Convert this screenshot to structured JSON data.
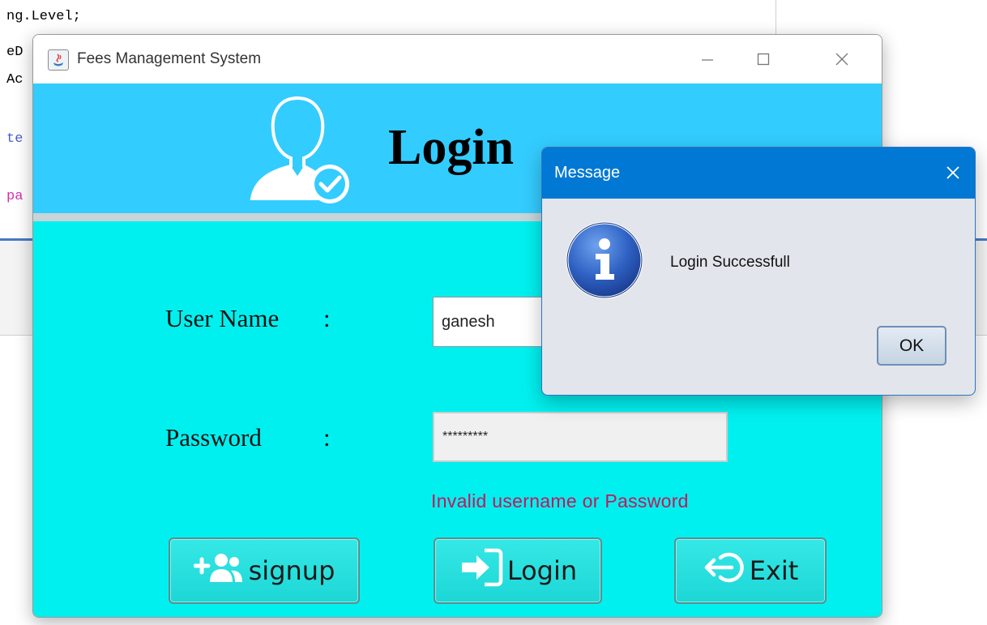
{
  "background_editor": {
    "lines": [
      "ng.Level;",
      "eD",
      "Ac",
      "te",
      "pa"
    ],
    "line_colors": [
      "#000000",
      "#000000",
      "#000000",
      "#4a5fc9",
      "#d62fb0"
    ]
  },
  "window": {
    "title": "Fees Management System",
    "icon": "java-icon",
    "controls": [
      "minimize-icon",
      "maximize-icon",
      "close-icon"
    ]
  },
  "header": {
    "title": "Login",
    "icon": "user-check-icon",
    "band_color": "#33ccff"
  },
  "form": {
    "username_label": "User Name",
    "username_colon": ":",
    "username_value": "ganesh",
    "password_label": "Password",
    "password_colon": ":",
    "password_value": "*********",
    "error_message": "Invalid username or Password",
    "error_color": "#c2185b",
    "body_color": "#00f0ef"
  },
  "buttons": {
    "signup": {
      "label": "signup",
      "icon": "add-users-icon"
    },
    "login": {
      "label": "Login",
      "icon": "sign-in-icon"
    },
    "exit": {
      "label": "Exit",
      "icon": "exit-icon"
    }
  },
  "dialog": {
    "title": "Message",
    "message": "Login Successfull",
    "ok_label": "OK",
    "icon": "info-icon",
    "titlebar_color": "#0078d4"
  }
}
